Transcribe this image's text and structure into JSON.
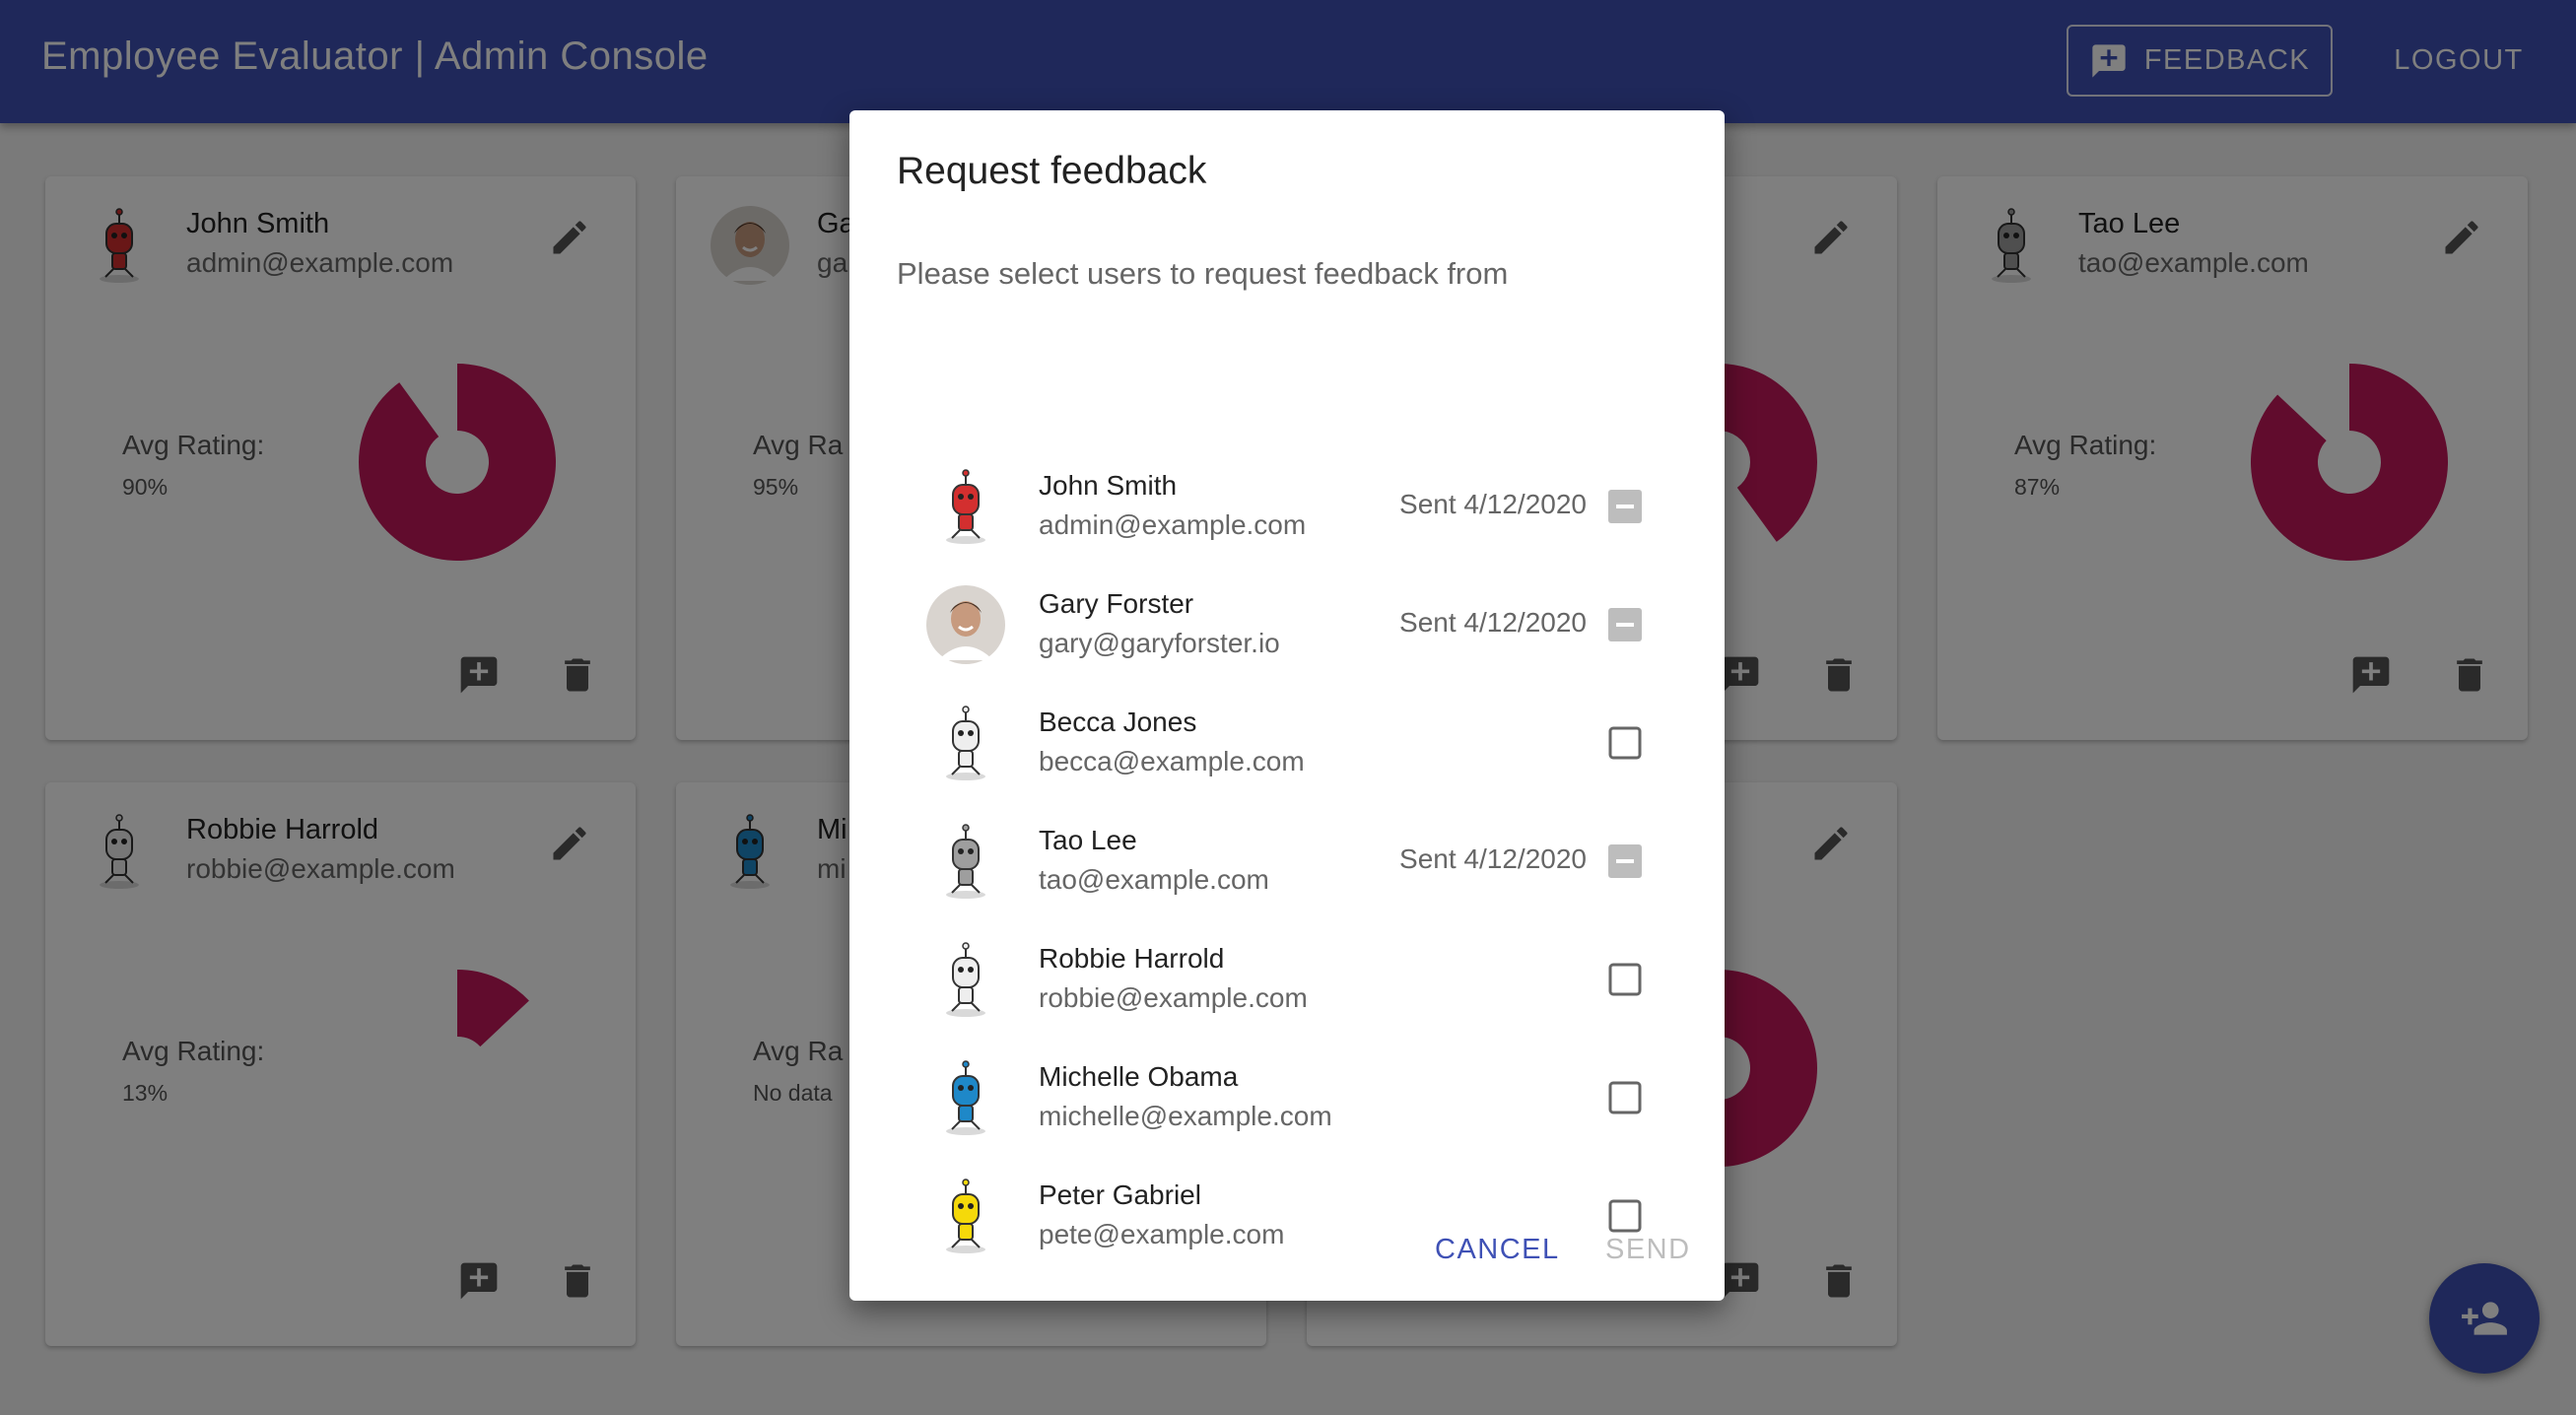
{
  "appbar": {
    "title": "Employee Evaluator | Admin Console",
    "feedback_label": "FEEDBACK",
    "logout_label": "LOGOUT",
    "color": "#3f51b5"
  },
  "cards": [
    {
      "name": "John Smith",
      "email": "admin@example.com",
      "avg_label": "Avg Rating:",
      "avg_value": "90%",
      "rating": 0.9
    },
    {
      "name": "Ga",
      "email": "ga",
      "avg_label": "Avg Ra",
      "avg_value": "95%",
      "rating": 0.95
    },
    {
      "name": "",
      "email": "",
      "avg_label": "",
      "avg_value": "",
      "rating": 0.4
    },
    {
      "name": "Tao Lee",
      "email": "tao@example.com",
      "avg_label": "Avg Rating:",
      "avg_value": "87%",
      "rating": 0.87
    },
    {
      "name": "Robbie Harrold",
      "email": "robbie@example.com",
      "avg_label": "Avg Rating:",
      "avg_value": "13%",
      "rating": 0.13
    },
    {
      "name": "Mi",
      "email": "mi",
      "avg_label": "Avg Ra",
      "avg_value": "No data",
      "rating": null
    },
    {
      "name": "",
      "email": "",
      "avg_label": "",
      "avg_value": "",
      "rating": 0.5
    }
  ],
  "dialog": {
    "title": "Request feedback",
    "subtitle": "Please select users to request feedback from",
    "users": [
      {
        "name": "John Smith",
        "email": "admin@example.com",
        "status": "Sent 4/12/2020",
        "state": "sent",
        "avatar": "red-robot-icon"
      },
      {
        "name": "Gary Forster",
        "email": "gary@garyforster.io",
        "status": "Sent 4/12/2020",
        "state": "sent",
        "avatar": "photo-avatar"
      },
      {
        "name": "Becca Jones",
        "email": "becca@example.com",
        "status": "",
        "state": "unchecked",
        "avatar": "white-robot-icon"
      },
      {
        "name": "Tao Lee",
        "email": "tao@example.com",
        "status": "Sent 4/12/2020",
        "state": "sent",
        "avatar": "gray-robot-icon"
      },
      {
        "name": "Robbie Harrold",
        "email": "robbie@example.com",
        "status": "",
        "state": "unchecked",
        "avatar": "white-robot-icon"
      },
      {
        "name": "Michelle Obama",
        "email": "michelle@example.com",
        "status": "",
        "state": "unchecked",
        "avatar": "blue-robot-icon"
      },
      {
        "name": "Peter Gabriel",
        "email": "pete@example.com",
        "status": "",
        "state": "unchecked",
        "avatar": "yellow-robot-icon"
      }
    ],
    "cancel_label": "CANCEL",
    "send_label": "SEND"
  },
  "colors": {
    "rating": "#c2185b",
    "primary": "#3f51b5"
  }
}
